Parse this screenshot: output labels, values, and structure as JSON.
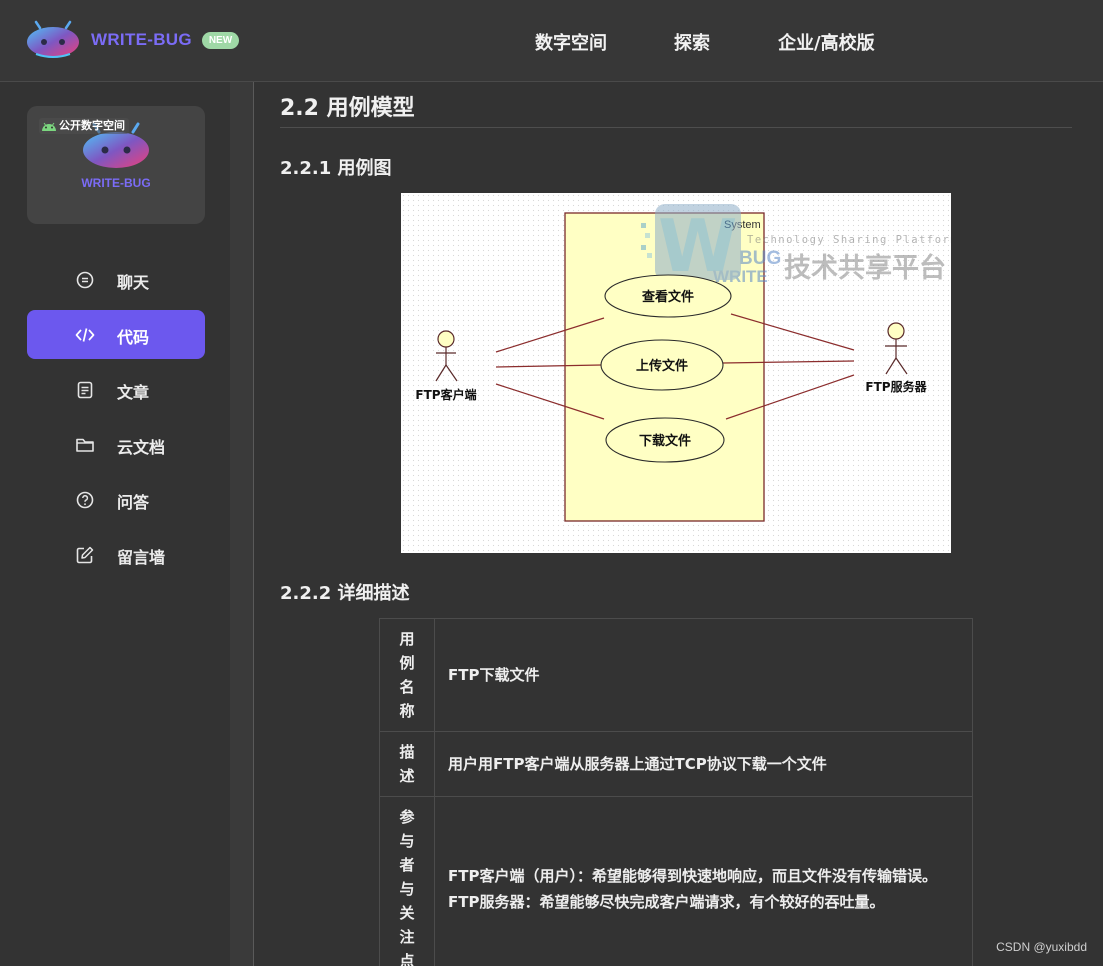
{
  "header": {
    "brand": "WRITE-BUG",
    "badge": "NEW",
    "nav": [
      "数字空间",
      "探索",
      "企业/高校版"
    ]
  },
  "sidebar": {
    "space_card": {
      "tag": "公开数字空间",
      "brand": "WRITE-BUG"
    },
    "items": [
      {
        "label": "聊天",
        "icon": "chat-icon",
        "active": false
      },
      {
        "label": "代码",
        "icon": "code-icon",
        "active": true
      },
      {
        "label": "文章",
        "icon": "article-icon",
        "active": false
      },
      {
        "label": "云文档",
        "icon": "folder-icon",
        "active": false
      },
      {
        "label": "问答",
        "icon": "question-icon",
        "active": false
      },
      {
        "label": "留言墙",
        "icon": "edit-icon",
        "active": false
      }
    ]
  },
  "content": {
    "section_title": "2.2 用例模型",
    "sub1": "2.2.1 用例图",
    "diagram": {
      "system_label": "System",
      "watermark_tagline": "Technology Sharing Platform",
      "watermark_cn": "技术共享平台",
      "watermark_w": "W",
      "watermark_bug": "BUG",
      "watermark_write": "WRITE",
      "actor_left": "FTP客户端",
      "actor_right": "FTP服务器",
      "use_cases": [
        "查看文件",
        "上传文件",
        "下载文件"
      ]
    },
    "sub2": "2.2.2 详细描述",
    "table": [
      {
        "key": "用例名称",
        "value": "FTP下载文件"
      },
      {
        "key": "描述",
        "value": "用户用FTP客户端从服务器上通过TCP协议下载一个文件"
      },
      {
        "key": "参与者与关注点",
        "value": "FTP客户端（用户）：希望能够得到快速地响应，而且文件没有传输错误。FTP服务器：希望能够尽快完成客户端请求，有个较好的吞吐量。"
      }
    ]
  },
  "footer": {
    "watermark": "CSDN @yuxibdd"
  },
  "colors": {
    "accent": "#6c58ee",
    "brand": "#7b6cf6",
    "badge": "#9fd8a6",
    "diagram_box": "#ffffc4",
    "diagram_line": "#8b2d2d"
  }
}
